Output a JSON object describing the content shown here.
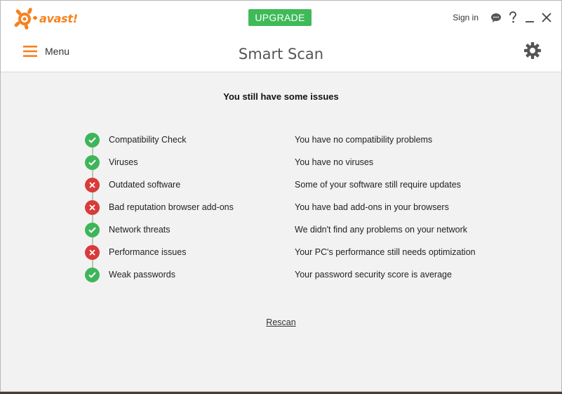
{
  "app": {
    "logo_text": "avast!"
  },
  "header": {
    "upgrade_label": "UPGRADE",
    "signin_label": "Sign in",
    "menu_label": "Menu",
    "title": "Smart Scan"
  },
  "summary": "You still have some issues",
  "results": [
    {
      "name": "Compatibility Check",
      "status": "ok",
      "description": "You have no compatibility problems"
    },
    {
      "name": "Viruses",
      "status": "ok",
      "description": "You have no viruses"
    },
    {
      "name": "Outdated software",
      "status": "issue",
      "description": "Some of your software still require updates"
    },
    {
      "name": "Bad reputation browser add-ons",
      "status": "issue",
      "description": "You have bad add-ons in your browsers"
    },
    {
      "name": "Network threats",
      "status": "ok",
      "description": "We didn't find any problems on your network"
    },
    {
      "name": "Performance issues",
      "status": "issue",
      "description": "Your PC's performance still needs optimization"
    },
    {
      "name": "Weak passwords",
      "status": "ok",
      "description": "Your password security score is average"
    }
  ],
  "rescan_label": "Rescan",
  "colors": {
    "brand_orange": "#f58220",
    "upgrade_green": "#3fba59",
    "ok_green": "#3fb55a",
    "issue_red": "#d93a3a"
  }
}
